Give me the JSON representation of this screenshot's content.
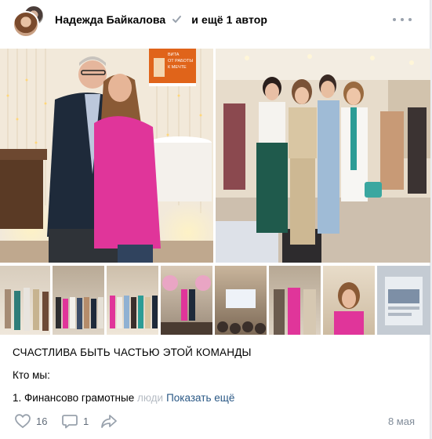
{
  "post": {
    "author": "Надежда Байкалова",
    "coauthor_text": "и ещё 1 автор",
    "title": "СЧАСТЛИВА БЫТЬ ЧАСТЬЮ ЭТОЙ КОМАНДЫ",
    "line1": "Кто мы:",
    "line2_visible": "1. Финансово грамотные ",
    "line2_faded": "люди",
    "show_more": "Показать ещё",
    "date": "8 мая"
  },
  "book_cover": {
    "line1": "ВИТА",
    "line2": "ОТ РАБОТЫ",
    "line3": "К МЕЧТЕ"
  },
  "actions": {
    "likes": "16",
    "comments": "1"
  },
  "icons": {
    "verified": "verified-check-icon",
    "more": "more-horizontal-icon",
    "like": "heart-icon",
    "comment": "comment-icon",
    "share": "share-arrow-icon"
  },
  "colors": {
    "link": "#2a5885",
    "muted": "#818c99",
    "icon": "#99a2ad",
    "card_bg": "#ffffff",
    "page_bg": "#ebedf0"
  }
}
